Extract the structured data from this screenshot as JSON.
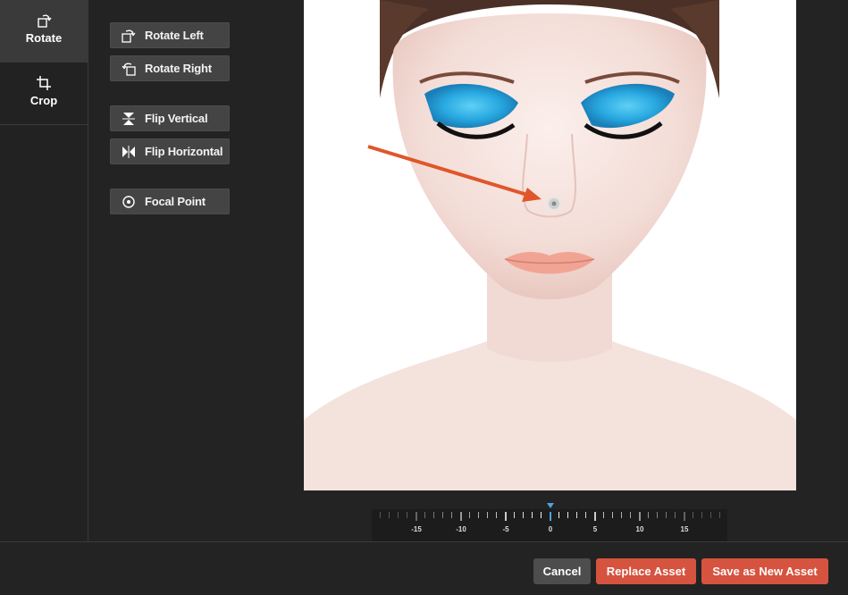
{
  "sidebar": {
    "tabs": [
      {
        "label": "Rotate",
        "icon": "rotate-icon",
        "active": true
      },
      {
        "label": "Crop",
        "icon": "crop-icon",
        "active": false
      }
    ]
  },
  "tools": {
    "rotate_left": "Rotate Left",
    "rotate_right": "Rotate Right",
    "flip_vertical": "Flip Vertical",
    "flip_horizontal": "Flip Horizontal",
    "focal_point": "Focal Point"
  },
  "ruler": {
    "labels": [
      "-15",
      "-10",
      "-5",
      "0",
      "5",
      "10",
      "15"
    ],
    "current_value": 0,
    "indicator_color": "#4aa3df"
  },
  "footer": {
    "cancel": "Cancel",
    "replace": "Replace Asset",
    "save_new": "Save as New Asset"
  },
  "colors": {
    "accent": "#d6533f",
    "arrow": "#e0562a",
    "eyeshadow": "#29a9e1"
  }
}
